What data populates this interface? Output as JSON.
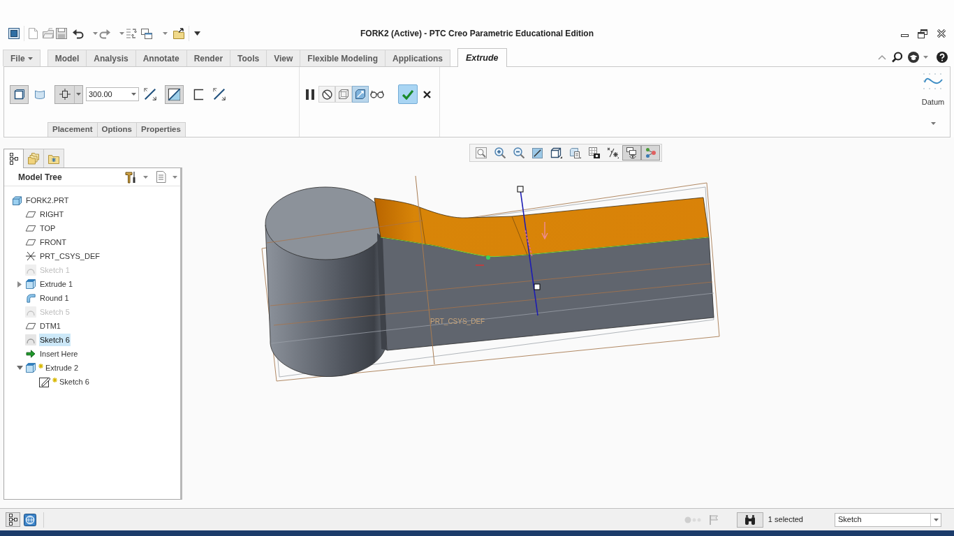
{
  "title_bar": {
    "title": "FORK2 (Active) - PTC Creo Parametric Educational Edition"
  },
  "ribbon_tabs": [
    {
      "label": "File",
      "kind": "menu",
      "selected": false
    },
    {
      "label": "Model",
      "kind": "tab",
      "selected": false
    },
    {
      "label": "Analysis",
      "kind": "tab",
      "selected": false
    },
    {
      "label": "Annotate",
      "kind": "tab",
      "selected": false
    },
    {
      "label": "Render",
      "kind": "tab",
      "selected": false
    },
    {
      "label": "Tools",
      "kind": "tab",
      "selected": false
    },
    {
      "label": "View",
      "kind": "tab",
      "selected": false
    },
    {
      "label": "Flexible Modeling",
      "kind": "tab",
      "selected": false
    },
    {
      "label": "Applications",
      "kind": "tab",
      "selected": false
    },
    {
      "label": "Extrude",
      "kind": "tab",
      "selected": true
    }
  ],
  "dashboard": {
    "tools": [
      {
        "kind": "solid",
        "pressed": true
      },
      {
        "kind": "surface",
        "pressed": false
      },
      {
        "kind": "depth-option"
      },
      {
        "kind": "depth-field",
        "value": "300.00"
      },
      {
        "kind": "flip",
        "pressed": false
      },
      {
        "kind": "remove-material",
        "pressed": true
      },
      {
        "kind": "thicken",
        "pressed": false
      },
      {
        "kind": "flip",
        "pressed": false
      }
    ],
    "subtabs": [
      {
        "label": "Placement"
      },
      {
        "label": "Options"
      },
      {
        "label": "Properties"
      }
    ],
    "preview_tools": [
      {
        "kind": "pause",
        "pressed": false
      },
      {
        "kind": "no-preview",
        "pressed": false
      },
      {
        "kind": "box-preview",
        "pressed": false
      },
      {
        "kind": "verify",
        "pressed": true
      },
      {
        "kind": "feature-preview",
        "pressed": false
      }
    ],
    "datum_group": {
      "label": "Datum"
    }
  },
  "model_tree": {
    "tabs": [
      {
        "kind": "tree",
        "selected": true
      },
      {
        "kind": "folder",
        "selected": false
      },
      {
        "kind": "favorites",
        "selected": false
      }
    ],
    "title": "Model Tree",
    "items": [
      {
        "label": "FORK2.PRT",
        "kind": "part",
        "selected": false,
        "greyed": false,
        "new": false,
        "children": [
          {
            "label": "RIGHT",
            "kind": "plane",
            "selected": false,
            "greyed": false,
            "new": false
          },
          {
            "label": "TOP",
            "kind": "plane",
            "selected": false,
            "greyed": false,
            "new": false
          },
          {
            "label": "FRONT",
            "kind": "plane",
            "selected": false,
            "greyed": false,
            "new": false
          },
          {
            "label": "PRT_CSYS_DEF",
            "kind": "csys",
            "selected": false,
            "greyed": false,
            "new": false
          },
          {
            "label": "Sketch 1",
            "kind": "sketch",
            "selected": false,
            "greyed": true,
            "new": false
          },
          {
            "label": "Extrude 1",
            "kind": "extrude",
            "selected": false,
            "greyed": false,
            "new": false,
            "expanded": false
          },
          {
            "label": "Round 1",
            "kind": "round",
            "selected": false,
            "greyed": false,
            "new": false
          },
          {
            "label": "Sketch 5",
            "kind": "sketch",
            "selected": false,
            "greyed": true,
            "new": false
          },
          {
            "label": "DTM1",
            "kind": "plane",
            "selected": false,
            "greyed": false,
            "new": false
          },
          {
            "label": "Sketch 6",
            "kind": "sketch",
            "selected": true,
            "greyed": false,
            "new": false
          },
          {
            "label": "Insert Here",
            "kind": "insert",
            "selected": false,
            "greyed": false,
            "new": false
          },
          {
            "label": "Extrude 2",
            "kind": "extrude",
            "selected": false,
            "greyed": false,
            "new": true,
            "expanded": true,
            "children": [
              {
                "label": "Sketch 6",
                "kind": "sketch-edit",
                "selected": false,
                "greyed": false,
                "new": true
              }
            ]
          }
        ]
      }
    ]
  },
  "viewport": {
    "view_tools": [
      {
        "kind": "refit",
        "pressed": false
      },
      {
        "kind": "zoom-in",
        "pressed": false
      },
      {
        "kind": "zoom-out",
        "pressed": false
      },
      {
        "kind": "repaint",
        "pressed": false
      },
      {
        "kind": "display-style",
        "pressed": false
      },
      {
        "kind": "saved-orientations",
        "pressed": false
      },
      {
        "kind": "view-manager",
        "pressed": false
      },
      {
        "kind": "datum-display",
        "pressed": false
      },
      {
        "kind": "layers",
        "pressed": true
      },
      {
        "kind": "annotations",
        "pressed": true
      }
    ],
    "csys_label": "PRT_CSYS_DEF"
  },
  "status_bar": {
    "selection": "1 selected",
    "filter": "Sketch"
  }
}
